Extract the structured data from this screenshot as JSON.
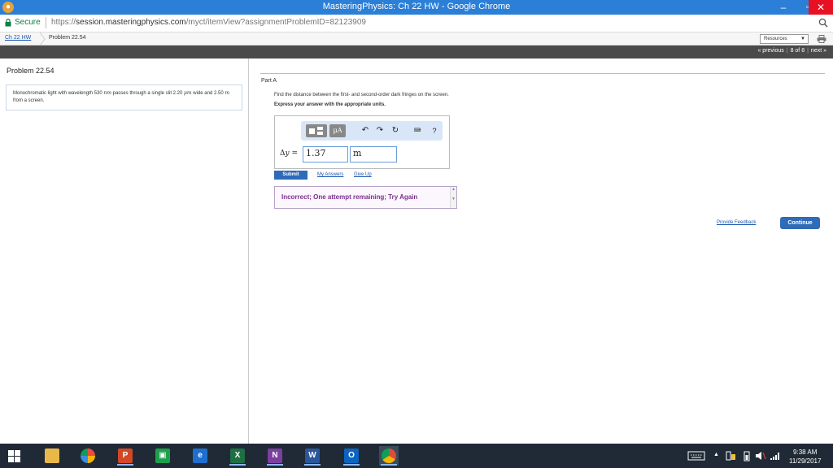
{
  "window": {
    "title": "MasteringPhysics: Ch 22 HW - Google Chrome",
    "minimize": "–",
    "maximize": "▫",
    "close": "✕"
  },
  "address": {
    "secure_label": "Secure",
    "url_scheme": "https://",
    "url_host": "session.masteringphysics.com",
    "url_path": "/myct/itemView?assignmentProblemID=82123909"
  },
  "breadcrumb": {
    "assignment": "Ch 22 HW",
    "problem": "Problem 22.54"
  },
  "resources": {
    "label": "Resources",
    "arrow": "▼"
  },
  "pager": {
    "previous": "« previous",
    "position": "8 of 8",
    "next": "next »"
  },
  "problem": {
    "title": "Problem 22.54",
    "text_before_unit1": "Monochromatic light with wavelength 530 ",
    "unit1": "nm",
    "text_after_unit1": " passes through a single slit 2.20 ",
    "unit2": "μm",
    "text_after_unit2": " wide and 2.50 ",
    "unit3": "m",
    "text_after_unit3": " from a screen."
  },
  "part": {
    "label": "Part A",
    "question": "Find the distance between the first- and second-order dark fringes on the screen.",
    "instruction": "Express your answer with the appropriate units."
  },
  "toolbar": {
    "units_label": "μA",
    "undo": "↶",
    "redo": "↷",
    "reset": "↻",
    "keyboard": "⌨",
    "help": "?"
  },
  "answer": {
    "variable_prefix": "Δ",
    "variable": "y",
    "equals": " =",
    "value": "1.37",
    "unit": "m"
  },
  "actions": {
    "submit": "Submit",
    "my_answers": "My Answers",
    "give_up": "Give Up"
  },
  "feedback": {
    "message": "Incorrect; One attempt remaining; Try Again"
  },
  "footer": {
    "provide_feedback": "Provide Feedback",
    "continue": "Continue"
  },
  "taskbar": {
    "apps": [
      {
        "name": "file-explorer",
        "glyph": "",
        "color": "#e8b94a"
      },
      {
        "name": "paint",
        "glyph": "",
        "color": "#3a8ee6"
      },
      {
        "name": "powerpoint",
        "glyph": "P",
        "color": "#d24726"
      },
      {
        "name": "store",
        "glyph": "▣",
        "color": "#1e9f4c"
      },
      {
        "name": "edge",
        "glyph": "e",
        "color": "#1f6fd0"
      },
      {
        "name": "excel",
        "glyph": "X",
        "color": "#1d7044"
      },
      {
        "name": "onenote",
        "glyph": "N",
        "color": "#7b3f9e"
      },
      {
        "name": "word",
        "glyph": "W",
        "color": "#2b579a"
      },
      {
        "name": "outlook",
        "glyph": "O",
        "color": "#0b64c0"
      },
      {
        "name": "chrome",
        "glyph": "",
        "color": "#dd4b39"
      }
    ],
    "time": "9:38 AM",
    "date": "11/29/2017"
  }
}
